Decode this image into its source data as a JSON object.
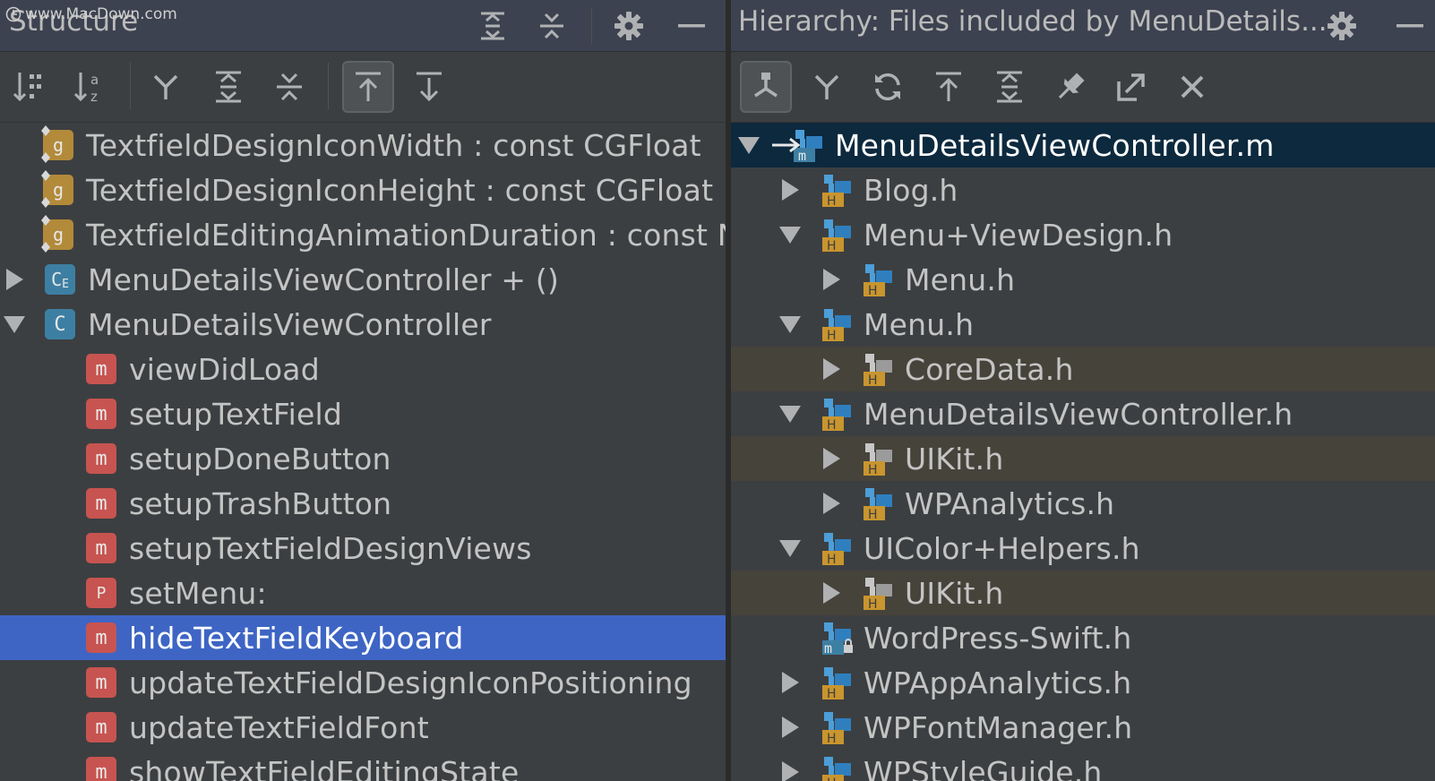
{
  "watermark": "www.MacDown.com",
  "structure": {
    "title": "Structure",
    "items": [
      {
        "label": "TextfieldDesignIconWidth : const CGFloat",
        "icon": "global-const-icon"
      },
      {
        "label": "TextfieldDesignIconHeight : const CGFloat",
        "icon": "global-const-icon"
      },
      {
        "label": "TextfieldEditingAnimationDuration : const N",
        "icon": "global-const-icon"
      },
      {
        "label": "MenuDetailsViewController + ()",
        "icon": "class-extension-icon"
      },
      {
        "label": "MenuDetailsViewController",
        "icon": "class-icon"
      },
      {
        "label": "viewDidLoad",
        "icon": "method-icon"
      },
      {
        "label": "setupTextField",
        "icon": "method-icon"
      },
      {
        "label": "setupDoneButton",
        "icon": "method-icon"
      },
      {
        "label": "setupTrashButton",
        "icon": "method-icon"
      },
      {
        "label": "setupTextFieldDesignViews",
        "icon": "method-icon"
      },
      {
        "label": "setMenu:",
        "icon": "property-icon"
      },
      {
        "label": "hideTextFieldKeyboard",
        "icon": "method-icon"
      },
      {
        "label": "updateTextFieldDesignIconPositioning",
        "icon": "method-icon"
      },
      {
        "label": "updateTextFieldFont",
        "icon": "method-icon"
      },
      {
        "label": "showTextFieldEditingState",
        "icon": "method-icon"
      }
    ]
  },
  "hierarchy": {
    "title": "Hierarchy:  Files included by MenuDetails...",
    "items": [
      {
        "label": "MenuDetailsViewController.m",
        "icon": "implementation-file-icon"
      },
      {
        "label": "Blog.h",
        "icon": "header-file-icon"
      },
      {
        "label": "Menu+ViewDesign.h",
        "icon": "header-file-icon"
      },
      {
        "label": "Menu.h",
        "icon": "header-file-icon"
      },
      {
        "label": "Menu.h",
        "icon": "header-file-icon"
      },
      {
        "label": "CoreData.h",
        "icon": "framework-header-icon"
      },
      {
        "label": "MenuDetailsViewController.h",
        "icon": "header-file-icon"
      },
      {
        "label": "UIKit.h",
        "icon": "framework-header-icon"
      },
      {
        "label": "WPAnalytics.h",
        "icon": "header-file-icon"
      },
      {
        "label": "UIColor+Helpers.h",
        "icon": "header-file-icon"
      },
      {
        "label": "UIKit.h",
        "icon": "framework-header-icon"
      },
      {
        "label": "WordPress-Swift.h",
        "icon": "locked-module-header-icon"
      },
      {
        "label": "WPAppAnalytics.h",
        "icon": "header-file-icon"
      },
      {
        "label": "WPFontManager.h",
        "icon": "header-file-icon"
      },
      {
        "label": "WPStyleGuide.h",
        "icon": "header-file-icon"
      }
    ]
  },
  "badges": {
    "global": "g",
    "class": "C",
    "class_ext": "C",
    "class_ext_sub": "E",
    "method": "m",
    "property": "P",
    "header": "H",
    "impl": "m"
  },
  "colors": {
    "selection": "#3e65c4",
    "root_selection": "#0d293e",
    "highlight": "#46433b",
    "method_badge": "#c75450",
    "class_badge": "#3d7fa3",
    "global_badge": "#b28a3a",
    "header_badge": "#c9952e"
  }
}
